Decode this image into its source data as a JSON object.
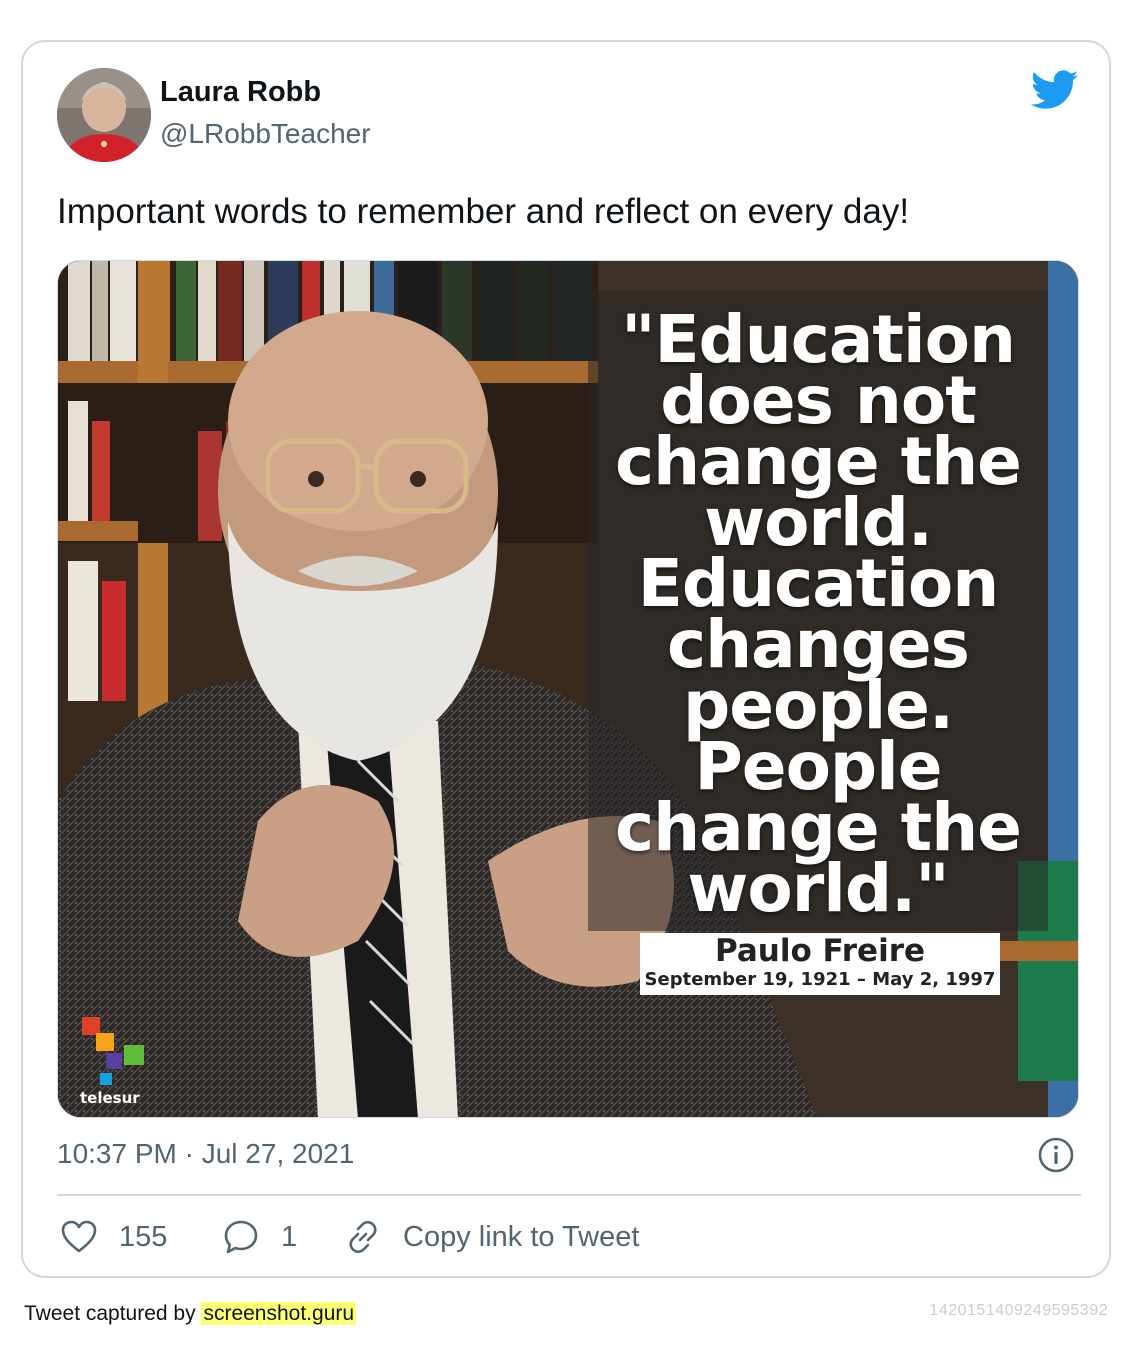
{
  "tweet": {
    "author_name": "Laura Robb",
    "author_handle": "@LRobbTeacher",
    "text": "Important words to remember and reflect on every day!",
    "timestamp": "10:37 PM · Jul 27, 2021",
    "likes": "155",
    "replies": "1",
    "copy_link_label": "Copy link to Tweet"
  },
  "media": {
    "quote": "\"Education does not change the world. Education changes people. People change the world.\"",
    "quote_lines": [
      "\"Education",
      "does not",
      "change the",
      "world.",
      "Education",
      "changes",
      "people.",
      "People",
      "change the",
      "world.\""
    ],
    "attribution_name": "Paulo Freire",
    "attribution_dates": "September 19, 1921 – May 2, 1997",
    "logo_text": "telesur"
  },
  "footer": {
    "captured_by": "Tweet captured by",
    "site": "screenshot.guru",
    "tweet_id": "1420151409249595392"
  },
  "colors": {
    "twitter_blue": "#1d9bf0",
    "secondary_text": "#536471",
    "border": "#cfd9de",
    "highlight": "#fdff73"
  },
  "icons": [
    "twitter-bird-icon",
    "info-icon",
    "heart-icon",
    "reply-icon",
    "link-icon"
  ]
}
